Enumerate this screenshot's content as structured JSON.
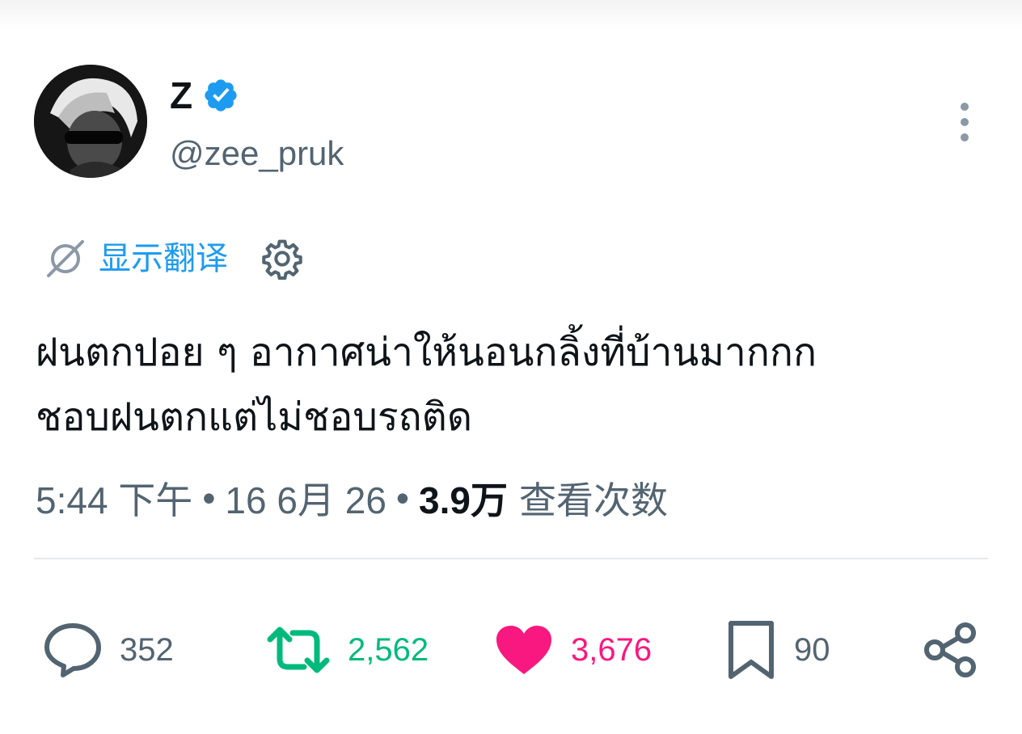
{
  "author": {
    "display_name": "Z",
    "handle": "@zee_pruk",
    "verified": true
  },
  "translate": {
    "label": "显示翻译"
  },
  "tweet": {
    "text": "ฝนตกปอย ๆ อากาศน่าให้นอนกลิ้งที่บ้านมากกก\nชอบฝนตกแต่ไม่ชอบรถติด"
  },
  "meta": {
    "time": "5:44 下午",
    "date": "16 6月 26",
    "views_count": "3.9万",
    "views_label": "查看次数",
    "separator": "•"
  },
  "actions": {
    "replies": "352",
    "retweets": "2,562",
    "likes": "3,676",
    "bookmarks": "90"
  },
  "colors": {
    "accent_blue": "#1d9bf0",
    "secondary_text": "#536471",
    "retweet_green": "#00ba7c",
    "like_pink": "#f91880",
    "primary_text": "#0f1419"
  },
  "icons": {
    "verified": "verified-badge-icon",
    "more": "more-vertical-icon",
    "translate": "translate-slash-icon",
    "settings": "gear-icon",
    "reply": "reply-bubble-icon",
    "retweet": "retweet-icon",
    "like": "heart-icon",
    "bookmark": "bookmark-icon",
    "share": "share-icon"
  }
}
